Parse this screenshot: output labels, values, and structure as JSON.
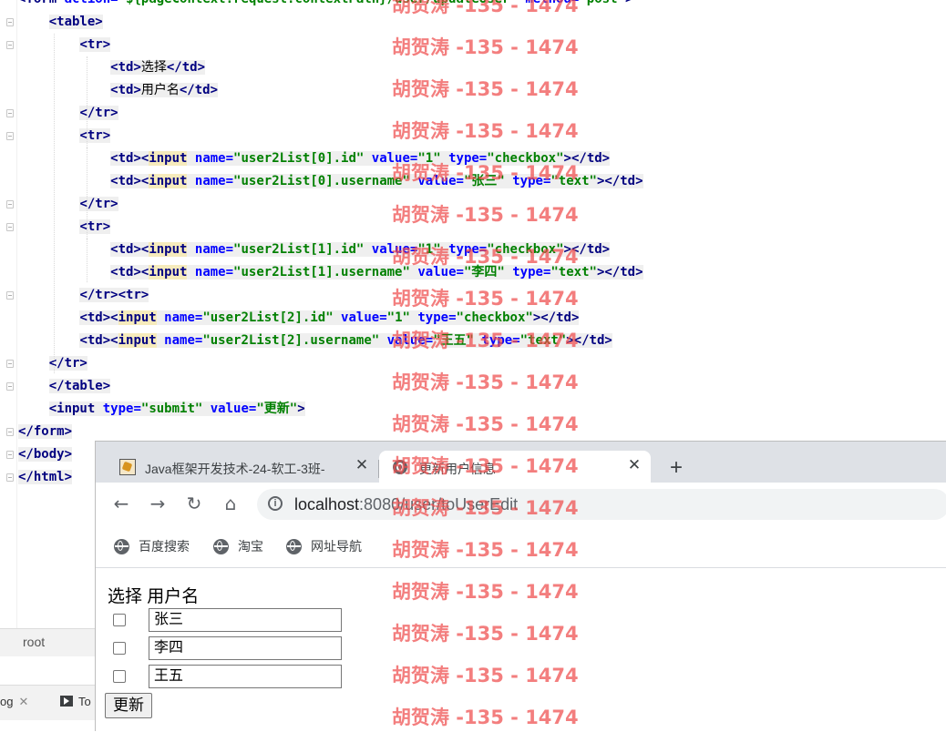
{
  "editor": {
    "lines": [
      [
        {
          "t": "<",
          "c": "tg"
        },
        {
          "t": "form ",
          "c": "tg"
        },
        {
          "t": "action=",
          "c": "at"
        },
        {
          "t": "\"${pageContext.request.contextPath}/user/updateUser\" ",
          "c": "vl"
        },
        {
          "t": "method=",
          "c": "at"
        },
        {
          "t": "\"post\"",
          "c": "vl"
        },
        {
          "t": ">",
          "c": "tg"
        }
      ],
      [
        {
          "t": "    "
        },
        {
          "t": "<table>",
          "c": "tg",
          "h": 1
        }
      ],
      [
        {
          "t": "        "
        },
        {
          "t": "<tr>",
          "c": "tg",
          "h": 1
        }
      ],
      [
        {
          "t": "            "
        },
        {
          "t": "<td>",
          "c": "tg",
          "h": 1
        },
        {
          "t": "选择",
          "c": "tx",
          "h": 1
        },
        {
          "t": "</td>",
          "c": "tg",
          "h": 1
        }
      ],
      [
        {
          "t": "            "
        },
        {
          "t": "<td>",
          "c": "tg",
          "h": 1
        },
        {
          "t": "用户名",
          "c": "tx",
          "h": 1
        },
        {
          "t": "</td>",
          "c": "tg",
          "h": 1
        }
      ],
      [
        {
          "t": "        "
        },
        {
          "t": "</tr>",
          "c": "tg",
          "h": 1
        }
      ],
      [
        {
          "t": "        "
        },
        {
          "t": "<tr>",
          "c": "tg",
          "h": 1
        }
      ],
      [
        {
          "t": "            "
        },
        {
          "t": "<td><",
          "c": "tg",
          "h": 1
        },
        {
          "t": "input",
          "c": "tg",
          "i": 1
        },
        {
          "t": " name=",
          "c": "at",
          "h": 1
        },
        {
          "t": "\"user2List[0].id\"",
          "c": "vl",
          "h": 1
        },
        {
          "t": " value=",
          "c": "at",
          "h": 1
        },
        {
          "t": "\"1\"",
          "c": "vl",
          "h": 1
        },
        {
          "t": " type=",
          "c": "at",
          "h": 1
        },
        {
          "t": "\"checkbox\"",
          "c": "vl",
          "h": 1
        },
        {
          "t": "></td>",
          "c": "tg",
          "h": 1
        }
      ],
      [
        {
          "t": "            "
        },
        {
          "t": "<td><",
          "c": "tg",
          "h": 1
        },
        {
          "t": "input",
          "c": "tg",
          "i": 1
        },
        {
          "t": " name=",
          "c": "at",
          "h": 1
        },
        {
          "t": "\"user2List[0].username\"",
          "c": "vl",
          "h": 1
        },
        {
          "t": " value=",
          "c": "at",
          "h": 1
        },
        {
          "t": "\"张三\"",
          "c": "vl",
          "h": 1
        },
        {
          "t": " type=",
          "c": "at",
          "h": 1
        },
        {
          "t": "\"text\"",
          "c": "vl",
          "h": 1
        },
        {
          "t": "></td>",
          "c": "tg",
          "h": 1
        }
      ],
      [
        {
          "t": "        "
        },
        {
          "t": "</tr>",
          "c": "tg",
          "h": 1
        }
      ],
      [
        {
          "t": "        "
        },
        {
          "t": "<tr>",
          "c": "tg",
          "h": 1
        }
      ],
      [
        {
          "t": "            "
        },
        {
          "t": "<td><",
          "c": "tg",
          "h": 1
        },
        {
          "t": "input",
          "c": "tg",
          "i": 1
        },
        {
          "t": " name=",
          "c": "at",
          "h": 1
        },
        {
          "t": "\"user2List[1].id\"",
          "c": "vl",
          "h": 1
        },
        {
          "t": " value=",
          "c": "at",
          "h": 1
        },
        {
          "t": "\"1\"",
          "c": "vl",
          "h": 1
        },
        {
          "t": " type=",
          "c": "at",
          "h": 1
        },
        {
          "t": "\"checkbox\"",
          "c": "vl",
          "h": 1
        },
        {
          "t": "></td>",
          "c": "tg",
          "h": 1
        }
      ],
      [
        {
          "t": "            "
        },
        {
          "t": "<td><",
          "c": "tg",
          "h": 1
        },
        {
          "t": "input",
          "c": "tg",
          "i": 1
        },
        {
          "t": " name=",
          "c": "at",
          "h": 1
        },
        {
          "t": "\"user2List[1].username\"",
          "c": "vl",
          "h": 1
        },
        {
          "t": " value=",
          "c": "at",
          "h": 1
        },
        {
          "t": "\"李四\"",
          "c": "vl",
          "h": 1
        },
        {
          "t": " type=",
          "c": "at",
          "h": 1
        },
        {
          "t": "\"text\"",
          "c": "vl",
          "h": 1
        },
        {
          "t": "></td>",
          "c": "tg",
          "h": 1
        }
      ],
      [
        {
          "t": "        "
        },
        {
          "t": "</tr><tr>",
          "c": "tg",
          "h": 1
        }
      ],
      [
        {
          "t": "        "
        },
        {
          "t": "<td><",
          "c": "tg",
          "h": 1
        },
        {
          "t": "input",
          "c": "tg",
          "i": 1
        },
        {
          "t": " name=",
          "c": "at",
          "h": 1
        },
        {
          "t": "\"user2List[2].id\"",
          "c": "vl",
          "h": 1
        },
        {
          "t": " value=",
          "c": "at",
          "h": 1
        },
        {
          "t": "\"1\"",
          "c": "vl",
          "h": 1
        },
        {
          "t": " type=",
          "c": "at",
          "h": 1
        },
        {
          "t": "\"checkbox\"",
          "c": "vl",
          "h": 1
        },
        {
          "t": "></td>",
          "c": "tg",
          "h": 1
        }
      ],
      [
        {
          "t": "        "
        },
        {
          "t": "<td><",
          "c": "tg",
          "h": 1
        },
        {
          "t": "input",
          "c": "tg",
          "i": 1
        },
        {
          "t": " name=",
          "c": "at",
          "h": 1
        },
        {
          "t": "\"user2List[2].username\"",
          "c": "vl",
          "h": 1
        },
        {
          "t": " value=",
          "c": "at",
          "h": 1
        },
        {
          "t": "\"王五\"",
          "c": "vl",
          "h": 1
        },
        {
          "t": " type=",
          "c": "at",
          "h": 1
        },
        {
          "t": "\"text\"",
          "c": "vl",
          "h": 1
        },
        {
          "t": "></td>",
          "c": "tg",
          "h": 1
        }
      ],
      [
        {
          "t": "    "
        },
        {
          "t": "</tr>",
          "c": "tg",
          "h": 1
        }
      ],
      [
        {
          "t": "    "
        },
        {
          "t": "</table>",
          "c": "tg",
          "h": 1
        }
      ],
      [
        {
          "t": "    "
        },
        {
          "t": "<input ",
          "c": "tg",
          "h": 1
        },
        {
          "t": "type=",
          "c": "at",
          "h": 1
        },
        {
          "t": "\"submit\" ",
          "c": "vl",
          "h": 1
        },
        {
          "t": "value=",
          "c": "at",
          "h": 1
        },
        {
          "t": "\"更新\"",
          "c": "vl",
          "h": 1
        },
        {
          "t": ">",
          "c": "tg",
          "h": 1
        }
      ],
      [
        {
          "t": "</form>",
          "c": "tg",
          "h": 1
        }
      ],
      [
        {
          "t": "</body>",
          "c": "tg",
          "h": 1
        }
      ],
      [
        {
          "t": "</html>",
          "c": "tg",
          "h": 1
        }
      ]
    ]
  },
  "ide": {
    "structure_label": "root",
    "tool_tab_log": "og",
    "tool_tab_todo": "To"
  },
  "browser": {
    "tabs": [
      {
        "title": "Java框架开发技术-24-软工-3班-",
        "close": "✕"
      },
      {
        "title": "更新用户信息",
        "close": "✕"
      }
    ],
    "new_tab": "+",
    "nav": {
      "back": "←",
      "forward": "→",
      "reload": "↻",
      "home": "⌂"
    },
    "url_host": "localhost",
    "url_rest": ":8080/user/toUserEdit",
    "bookmarks": [
      "百度搜索",
      "淘宝",
      "网址导航"
    ]
  },
  "page": {
    "header": "选择 用户名",
    "rows": [
      {
        "checked": false,
        "username": "张三"
      },
      {
        "checked": false,
        "username": "李四"
      },
      {
        "checked": false,
        "username": "王五"
      }
    ],
    "submit": "更新"
  },
  "watermark": "胡贺涛 -135 - 1474",
  "colors": {
    "tag": "#000080",
    "attr": "#0000ff",
    "value": "#008000",
    "watermark": "#ef4d4d"
  }
}
